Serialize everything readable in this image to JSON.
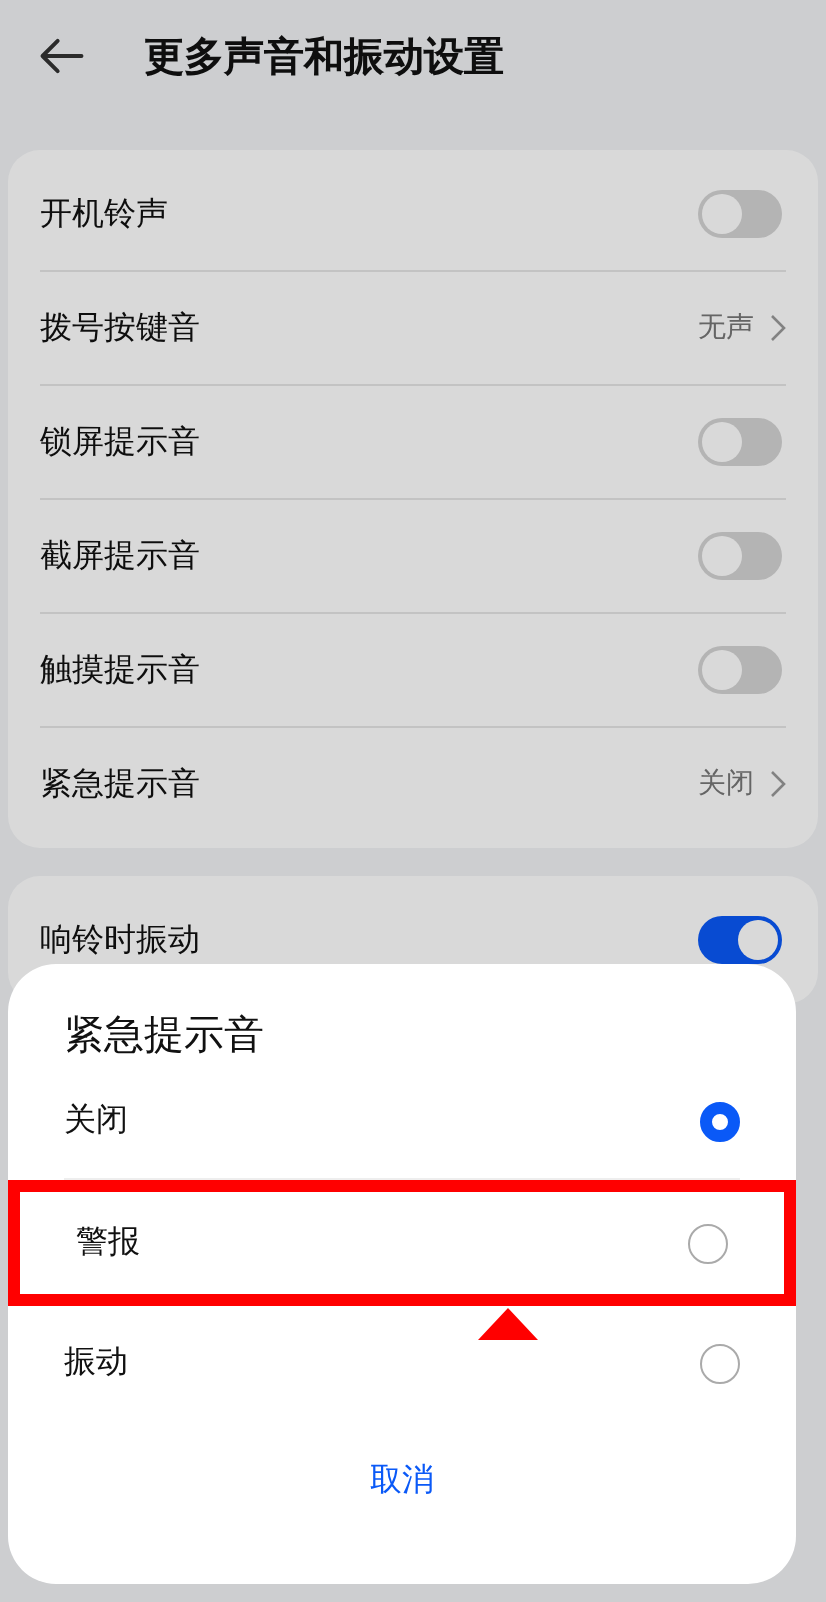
{
  "header": {
    "title": "更多声音和振动设置"
  },
  "settings": [
    {
      "label": "开机铃声",
      "kind": "switch",
      "on": false
    },
    {
      "label": "拨号按键音",
      "kind": "link",
      "value": "无声"
    },
    {
      "label": "锁屏提示音",
      "kind": "switch",
      "on": false
    },
    {
      "label": "截屏提示音",
      "kind": "switch",
      "on": false
    },
    {
      "label": "触摸提示音",
      "kind": "switch",
      "on": false
    },
    {
      "label": "紧急提示音",
      "kind": "link",
      "value": "关闭"
    }
  ],
  "settings_2": [
    {
      "label": "响铃时振动",
      "kind": "switch",
      "on": true
    }
  ],
  "dialog": {
    "title": "紧急提示音",
    "options": [
      {
        "label": "关闭",
        "selected": true,
        "highlighted": false
      },
      {
        "label": "警报",
        "selected": false,
        "highlighted": true
      },
      {
        "label": "振动",
        "selected": false,
        "highlighted": false
      }
    ],
    "cancel": "取消"
  }
}
